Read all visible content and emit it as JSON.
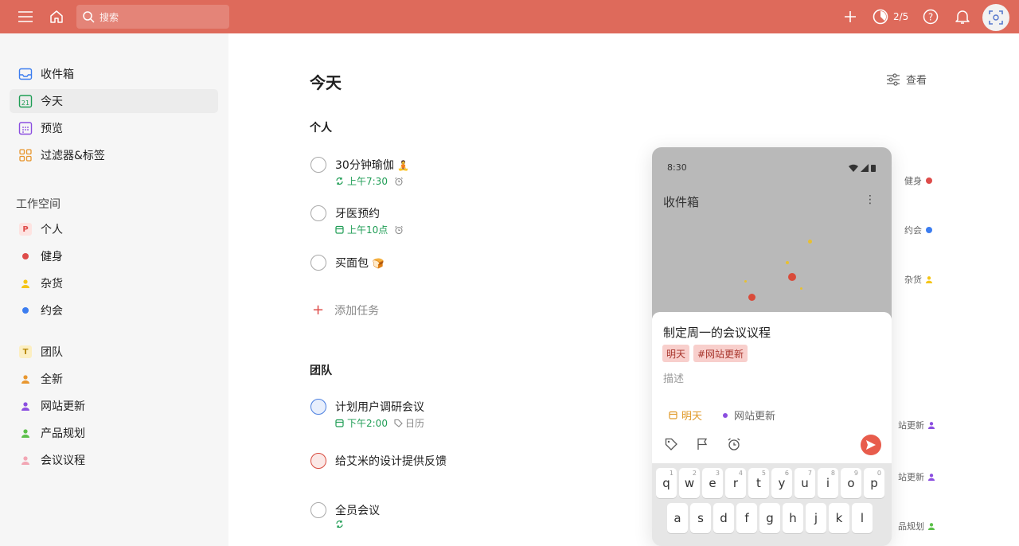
{
  "topbar": {
    "search_placeholder": "搜索",
    "karma_progress": "2/5"
  },
  "sidebar": {
    "main_items": [
      {
        "label": "收件箱",
        "icon": "inbox-icon"
      },
      {
        "label": "今天",
        "icon": "calendar-today-icon",
        "icon_text": "21"
      },
      {
        "label": "预览",
        "icon": "upcoming-calendar-icon"
      },
      {
        "label": "过滤器&标签",
        "icon": "filters-grid-icon"
      }
    ],
    "workspace_heading": "工作空间",
    "personal_projects": [
      {
        "label": "个人",
        "icon_text": "P",
        "color": "#de4c4a"
      },
      {
        "label": "健身",
        "color": "#de4c4a"
      },
      {
        "label": "杂货",
        "color": "#f5c518"
      },
      {
        "label": "约会",
        "color": "#3c7df0"
      }
    ],
    "team_projects": [
      {
        "label": "团队",
        "icon_text": "T",
        "color": "#f3c74a"
      },
      {
        "label": "全新",
        "color": "#e8962e"
      },
      {
        "label": "网站更新",
        "color": "#8b4ee0"
      },
      {
        "label": "产品规划",
        "color": "#5cc04a"
      },
      {
        "label": "会议议程",
        "color": "#f2a6b4"
      }
    ]
  },
  "main": {
    "title": "今天",
    "view_label": "查看",
    "sections": [
      {
        "heading": "个人",
        "tasks": [
          {
            "title": "30分钟瑜伽",
            "emoji": "🧘",
            "time": "上午7:30"
          },
          {
            "title": "牙医预约",
            "time": "上午10点"
          },
          {
            "title": "买面包",
            "emoji": "🍞"
          }
        ],
        "add_task_label": "添加任务"
      },
      {
        "heading": "团队",
        "tasks": [
          {
            "title": "计划用户调研会议",
            "time": "下午2:00",
            "label": "日历"
          },
          {
            "title": "给艾米的设计提供反馈"
          },
          {
            "title": "全员会议"
          }
        ]
      }
    ]
  },
  "right_column": [
    {
      "label": "健身",
      "color": "#de4c4a"
    },
    {
      "label": "约会",
      "color": "#3c7df0"
    },
    {
      "label": "杂货",
      "color": "#f5c518"
    },
    {
      "label": "站更新",
      "color": "#8b4ee0"
    },
    {
      "label": "站更新",
      "color": "#8b4ee0"
    },
    {
      "label": "品规划",
      "color": "#5cc04a"
    }
  ],
  "phone": {
    "time": "8:30",
    "screen_title": "收件箱",
    "quick_add": {
      "task_title": "制定周一的会议议程",
      "chip_date": "明天",
      "chip_label": "#网站更新",
      "description_placeholder": "描述",
      "due_date": "明天",
      "project": "网站更新"
    },
    "keyboard": {
      "row1": [
        {
          "key": "q",
          "hint": "1"
        },
        {
          "key": "w",
          "hint": "2"
        },
        {
          "key": "e",
          "hint": "3"
        },
        {
          "key": "r",
          "hint": "4"
        },
        {
          "key": "t",
          "hint": "5"
        },
        {
          "key": "y",
          "hint": "6"
        },
        {
          "key": "u",
          "hint": "7"
        },
        {
          "key": "i",
          "hint": "8"
        },
        {
          "key": "o",
          "hint": "9"
        },
        {
          "key": "p",
          "hint": "0"
        }
      ],
      "row2": [
        "a",
        "s",
        "d",
        "f",
        "g",
        "h",
        "j",
        "k",
        "l"
      ]
    }
  }
}
